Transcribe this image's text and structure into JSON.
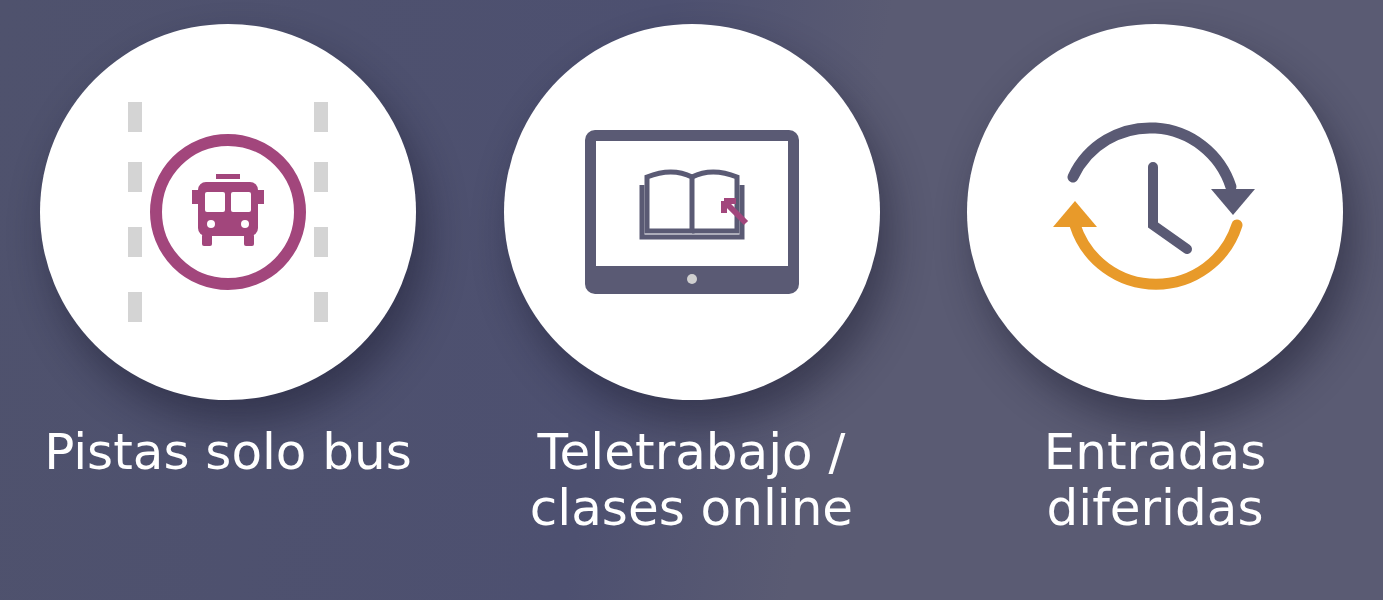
{
  "items": [
    {
      "kind": "bus",
      "label": "Pistas solo bus"
    },
    {
      "kind": "telework",
      "label": "Teletrabajo / clases online"
    },
    {
      "kind": "clock",
      "label": "Entradas diferidas"
    }
  ]
}
